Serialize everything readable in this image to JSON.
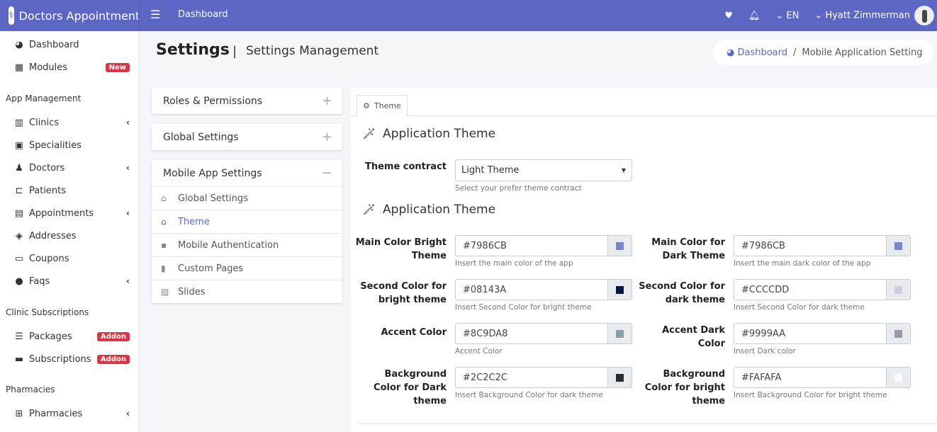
{
  "app": {
    "title": "Doctors Appointment",
    "nav_title": "Dashboard",
    "language": "EN",
    "user": "Hyatt Zimmerman",
    "accent": "#5b67c2"
  },
  "sidebar": {
    "items_top": [
      {
        "label": "Dashboard",
        "icon": "tachometer-icon"
      },
      {
        "label": "Modules",
        "icon": "grid-icon",
        "badge": "New"
      }
    ],
    "sections": [
      {
        "title": "App Management",
        "items": [
          {
            "label": "Clinics",
            "icon": "building-icon",
            "chevron": true
          },
          {
            "label": "Specialities",
            "icon": "medical-book-icon"
          },
          {
            "label": "Doctors",
            "icon": "doctor-icon",
            "chevron": true
          },
          {
            "label": "Patients",
            "icon": "bed-icon"
          },
          {
            "label": "Appointments",
            "icon": "calendar-check-icon",
            "chevron": true
          },
          {
            "label": "Addresses",
            "icon": "map-marker-icon"
          },
          {
            "label": "Coupons",
            "icon": "ticket-icon"
          },
          {
            "label": "Faqs",
            "icon": "question-circle-icon",
            "chevron": true
          }
        ]
      },
      {
        "title": "Clinic Subscriptions",
        "items": [
          {
            "label": "Packages",
            "icon": "list-icon",
            "badge": "Addon"
          },
          {
            "label": "Subscriptions",
            "icon": "id-card-icon",
            "badge": "Addon"
          }
        ]
      },
      {
        "title": "Pharmacies",
        "items": [
          {
            "label": "Pharmacies",
            "icon": "first-aid-icon",
            "chevron": true
          }
        ]
      }
    ]
  },
  "page": {
    "title": "Settings",
    "subtitle": "Settings Management",
    "breadcrumb": [
      "Dashboard",
      "Mobile Application Setting"
    ]
  },
  "accordion": [
    {
      "label": "Roles & Permissions",
      "toggle": "+"
    },
    {
      "label": "Global Settings",
      "toggle": "+"
    },
    {
      "label": "Mobile App Settings",
      "toggle": "−",
      "items": [
        {
          "label": "Global Settings",
          "icon": "inbox-icon"
        },
        {
          "label": "Theme",
          "icon": "inbox-icon",
          "active": true
        },
        {
          "label": "Mobile Authentication",
          "icon": "comment-icon"
        },
        {
          "label": "Custom Pages",
          "icon": "file-icon"
        },
        {
          "label": "Slides",
          "icon": "images-icon"
        }
      ]
    }
  ],
  "tab": {
    "label": "Theme"
  },
  "theme": {
    "section1": "Application Theme",
    "contract_label": "Theme contract",
    "contract_value": "Light Theme",
    "contract_help": "Select your prefer theme contract",
    "section2": "Application Theme",
    "fields": [
      {
        "label": "Main Color Bright Theme",
        "value": "#7986CB",
        "help": "Insert the main color of the app"
      },
      {
        "label": "Main Color for Dark Theme",
        "value": "#7986CB",
        "help": "Insert the main dark color of the app"
      },
      {
        "label": "Second Color for bright theme",
        "value": "#08143A",
        "help": "Insert Second Color for bright theme"
      },
      {
        "label": "Second Color for dark theme",
        "value": "#CCCCDD",
        "help": "Insert Second Color for dark theme"
      },
      {
        "label": "Accent Color",
        "value": "#8C9DA8",
        "help": "Accent Color"
      },
      {
        "label": "Accent Dark Color",
        "value": "#9999AA",
        "help": "Insert Dark color"
      },
      {
        "label": "Background Color for Dark theme",
        "value": "#2C2C2C",
        "help": "Insert Background Color for dark theme"
      },
      {
        "label": "Background Color for bright theme",
        "value": "#FAFAFA",
        "help": "Insert Background Color for bright theme"
      }
    ]
  }
}
